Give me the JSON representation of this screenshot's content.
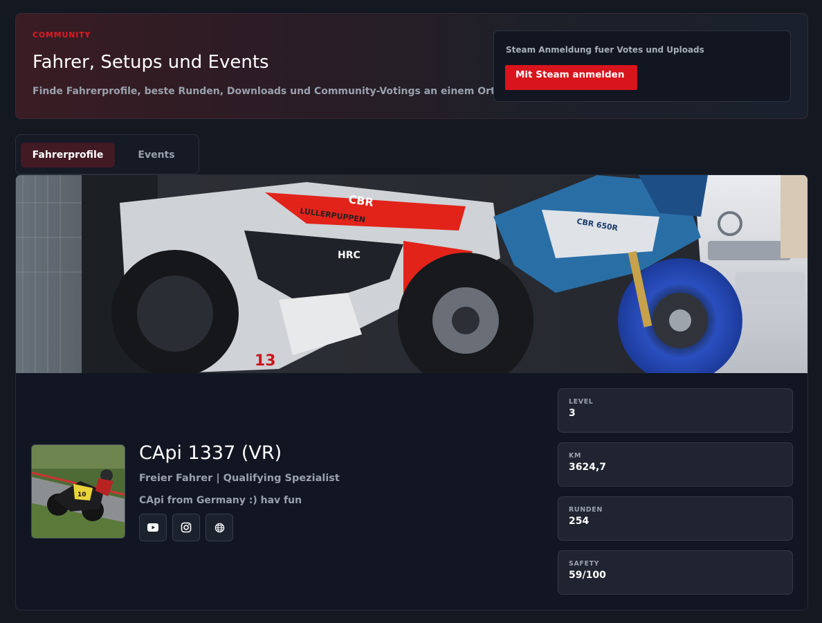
{
  "hero": {
    "eyebrow": "COMMUNITY",
    "title": "Fahrer, Setups und Events",
    "subtitle": "Finde Fahrerprofile, beste Runden, Downloads und Community-Votings an einem Ort.",
    "login": {
      "text": "Steam Anmeldung fuer Votes und Uploads",
      "button_label": "Mit Steam anmelden"
    }
  },
  "tabs": [
    {
      "label": "Fahrerprofile",
      "active": true
    },
    {
      "label": "Events",
      "active": false
    }
  ],
  "profile": {
    "name": "CApi 1337 (VR)",
    "role": "Freier Fahrer | Qualifying Spezialist",
    "bio": "CApi from Germany :) hav fun",
    "social_icons": [
      "youtube-icon",
      "instagram-icon",
      "globe-icon"
    ],
    "banner_texts": [
      "LULLERPUPPEN",
      "CBR",
      "HRC",
      "13",
      "CBR 650R"
    ],
    "avatar_number": "10",
    "stats": [
      {
        "label": "LEVEL",
        "value": "3"
      },
      {
        "label": "KM",
        "value": "3624,7"
      },
      {
        "label": "RUNDEN",
        "value": "254"
      },
      {
        "label": "SAFETY",
        "value": "59/100"
      }
    ]
  },
  "colors": {
    "background": "#131821",
    "accent": "#d8141d",
    "eyebrow": "#e11b22",
    "tab_active": "#421a24",
    "card": "#111622",
    "stat_card": "#1f2430",
    "muted_text": "#9aa1ad"
  }
}
